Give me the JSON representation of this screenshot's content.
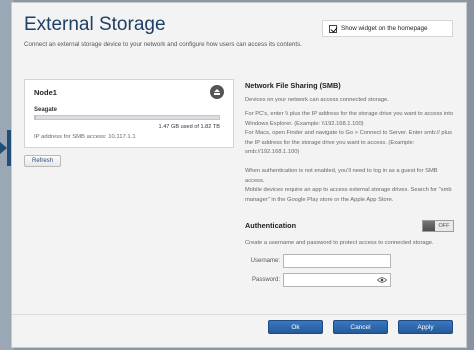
{
  "header": {
    "title": "External Storage",
    "subtitle": "Connect an external storage device to your network and configure how users can access its contents.",
    "widget_checkbox_label": "Show widget on the homepage",
    "widget_checked": true
  },
  "node": {
    "name": "Node1",
    "drive_name": "Seagate",
    "usage_text": "1.47 GB used of 1.82 TB",
    "usage_fraction": 0.001,
    "ip_text": "IP address for SMB access: 10.117.1.1"
  },
  "buttons": {
    "refresh": "Refresh",
    "ok": "Ok",
    "cancel": "Cancel",
    "apply": "Apply"
  },
  "smb": {
    "heading": "Network File Sharing (SMB)",
    "paragraphs": [
      "Devices on your network can access connected storage.",
      "For PC's, enter \\\\ plus the IP address for the storage drive you want to access into Windows Explorer. (Example: \\\\192.168.1.100)",
      "For Macs, open Finder and navigate to Go > Connect to Server. Enter smb:// plus the IP address for the storage drive you want to access. (Example: smb://192.168.1.100)",
      "When authentication is not enabled, you'll need to log in as a guest for SMB access.",
      "Mobile devices require an app to access external storage drives. Search for \"smb manager\" in the Google Play store or the Apple App Store."
    ]
  },
  "auth": {
    "heading": "Authentication",
    "toggle_state": "OFF",
    "description": "Create a username and password to protect access to connected storage.",
    "username_label": "Username:",
    "password_label": "Password:",
    "username_value": "",
    "password_value": ""
  },
  "colors": {
    "accent": "#1f3f66",
    "button_blue": "#2f6aad"
  },
  "icons": {
    "eject": "eject-icon",
    "eye": "eye-icon",
    "checkbox": "checkbox-checked-icon"
  }
}
